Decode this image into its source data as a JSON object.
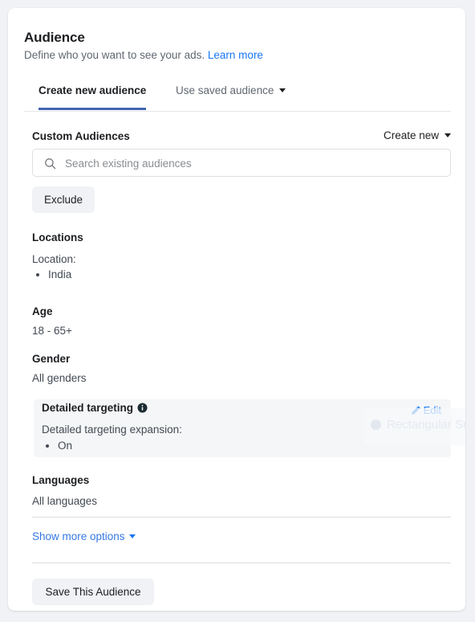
{
  "panel": {
    "title": "Audience",
    "subtitle_text": "Define who you want to see your ads.",
    "learn_more": "Learn more"
  },
  "tabs": [
    {
      "label": "Create new audience",
      "active": true
    },
    {
      "label": "Use saved audience",
      "active": false,
      "has_caret": true
    }
  ],
  "custom_audiences": {
    "label": "Custom Audiences",
    "create_new": "Create new",
    "search_placeholder": "Search existing audiences",
    "search_value": "",
    "exclude_label": "Exclude"
  },
  "locations": {
    "heading": "Locations",
    "sub_label": "Location:",
    "items": [
      "India"
    ]
  },
  "age": {
    "heading": "Age",
    "value": "18 - 65+"
  },
  "gender": {
    "heading": "Gender",
    "value": "All genders"
  },
  "detailed_targeting": {
    "heading": "Detailed targeting",
    "info_icon": "info-icon",
    "edit_label": "Edit",
    "edit_icon": "pencil-icon",
    "sub_label": "Detailed targeting expansion:",
    "items": [
      "On"
    ]
  },
  "languages": {
    "heading": "Languages",
    "value": "All languages"
  },
  "footer": {
    "show_more_options": "Show more options",
    "save_audience": "Save This Audience"
  },
  "watermark": {
    "text": "Rectangular Snip"
  },
  "colors": {
    "accent_blue": "#1877f2",
    "tab_underline": "#4267b2",
    "link_blue": "#3578e5",
    "text_primary": "#1c1e21",
    "text_secondary": "#606770",
    "panel_bg": "#ffffff",
    "page_bg": "#f0f2f5",
    "highlight_bg": "#f5f6f7",
    "button_bg": "#f0f2f5"
  }
}
